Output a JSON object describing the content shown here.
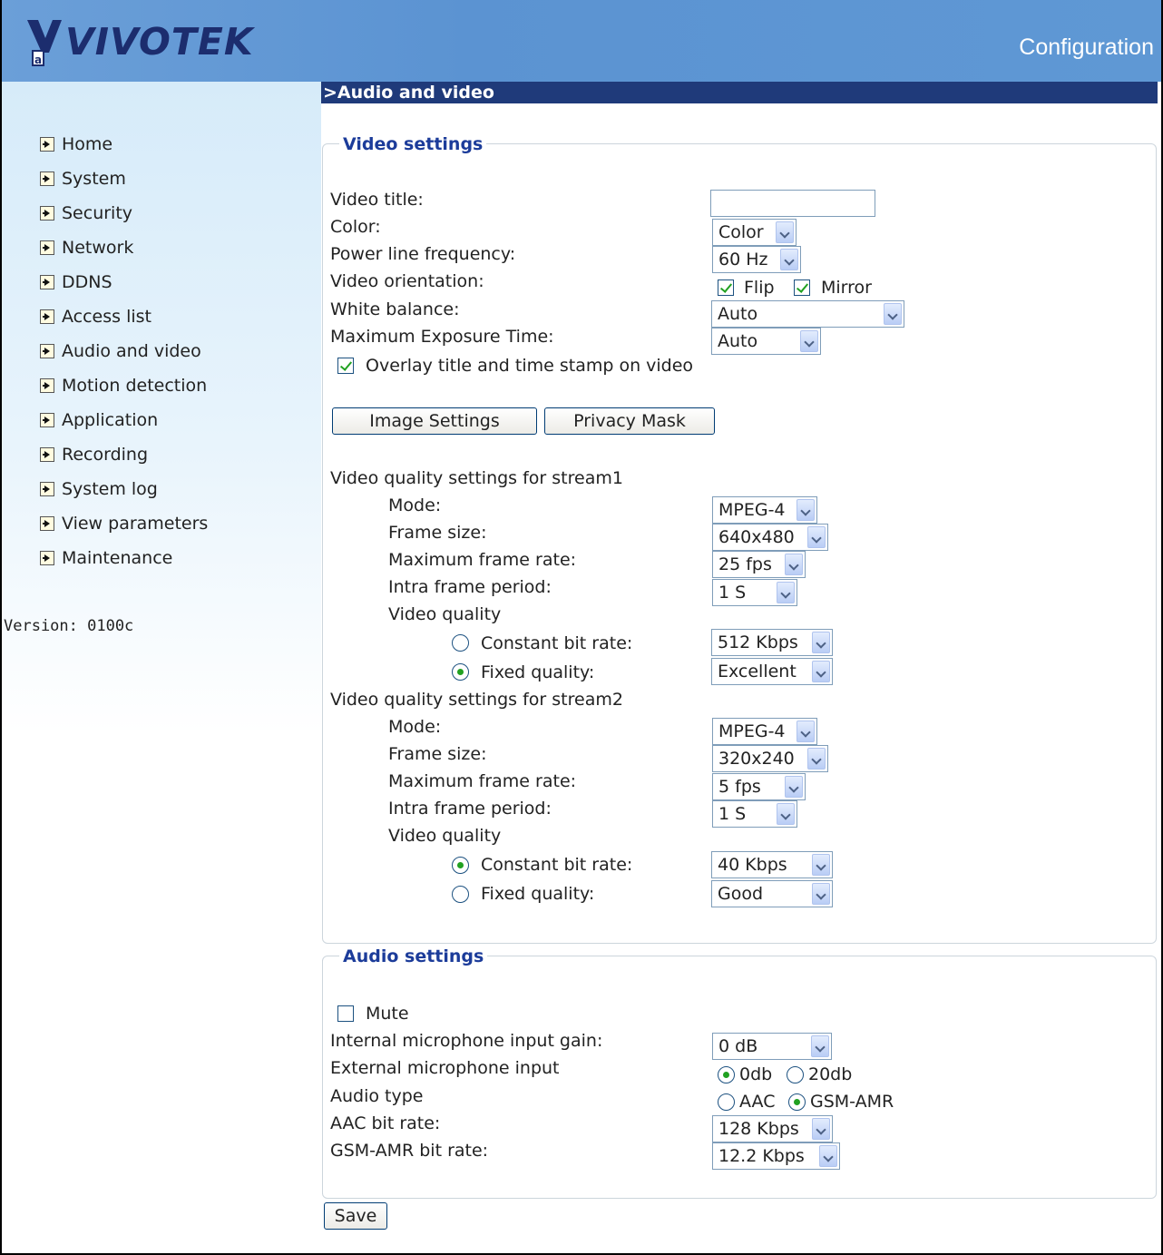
{
  "header": {
    "logo_text": "VIVOTEK",
    "title": "Configuration"
  },
  "sidebar": {
    "items": [
      {
        "label": "Home"
      },
      {
        "label": "System"
      },
      {
        "label": "Security"
      },
      {
        "label": "Network"
      },
      {
        "label": "DDNS"
      },
      {
        "label": "Access list"
      },
      {
        "label": "Audio and video"
      },
      {
        "label": "Motion detection"
      },
      {
        "label": "Application"
      },
      {
        "label": "Recording"
      },
      {
        "label": "System log"
      },
      {
        "label": "View parameters"
      },
      {
        "label": "Maintenance"
      }
    ],
    "version": "Version: 0100c"
  },
  "section_title": ">Audio and video",
  "video": {
    "legend": "Video settings",
    "video_title_label": "Video title:",
    "video_title_value": "",
    "color_label": "Color:",
    "color_value": "Color",
    "power_label": "Power line frequency:",
    "power_value": "60 Hz",
    "orientation_label": "Video orientation:",
    "flip_label": "Flip",
    "mirror_label": "Mirror",
    "flip_checked": true,
    "mirror_checked": true,
    "wb_label": "White balance:",
    "wb_value": "Auto",
    "exposure_label": "Maximum Exposure Time:",
    "exposure_value": "Auto",
    "overlay_label": "Overlay title and time stamp on video",
    "overlay_checked": true,
    "image_settings_btn": "Image Settings",
    "privacy_mask_btn": "Privacy Mask",
    "streams": [
      {
        "heading": "Video quality settings for stream1",
        "mode_label": "Mode:",
        "mode_value": "MPEG-4",
        "frame_size_label": "Frame size:",
        "frame_size_value": "640x480",
        "max_fr_label": "Maximum frame rate:",
        "max_fr_value": "25 fps",
        "intra_label": "Intra frame period:",
        "intra_value": "1 S",
        "vq_label": "Video quality",
        "cbr_label": "Constant bit rate:",
        "cbr_value": "512 Kbps",
        "fq_label": "Fixed quality:",
        "fq_value": "Excellent",
        "selected": "fixed"
      },
      {
        "heading": "Video quality settings for stream2",
        "mode_label": "Mode:",
        "mode_value": "MPEG-4",
        "frame_size_label": "Frame size:",
        "frame_size_value": "320x240",
        "max_fr_label": "Maximum frame rate:",
        "max_fr_value": "5 fps",
        "intra_label": "Intra frame period:",
        "intra_value": "1 S",
        "vq_label": "Video quality",
        "cbr_label": "Constant bit rate:",
        "cbr_value": "40 Kbps",
        "fq_label": "Fixed quality:",
        "fq_value": "Good",
        "selected": "cbr"
      }
    ]
  },
  "audio": {
    "legend": "Audio settings",
    "mute_label": "Mute",
    "mute_checked": false,
    "gain_label": "Internal microphone input gain:",
    "gain_value": "0 dB",
    "ext_label": "External microphone input",
    "ext_opt1": "0db",
    "ext_opt2": "20db",
    "ext_selected": "0db",
    "type_label": "Audio type",
    "type_opt1": "AAC",
    "type_opt2": "GSM-AMR",
    "type_selected": "GSM-AMR",
    "aac_label": "AAC bit rate:",
    "aac_value": "128 Kbps",
    "gsm_label": "GSM-AMR bit rate:",
    "gsm_value": "12.2 Kbps"
  },
  "save_label": "Save",
  "colors": {
    "header_blue": "#5f98d4",
    "section_bar": "#1f3a7a",
    "legend_blue": "#1c3c9a",
    "check_green": "#21a121"
  }
}
